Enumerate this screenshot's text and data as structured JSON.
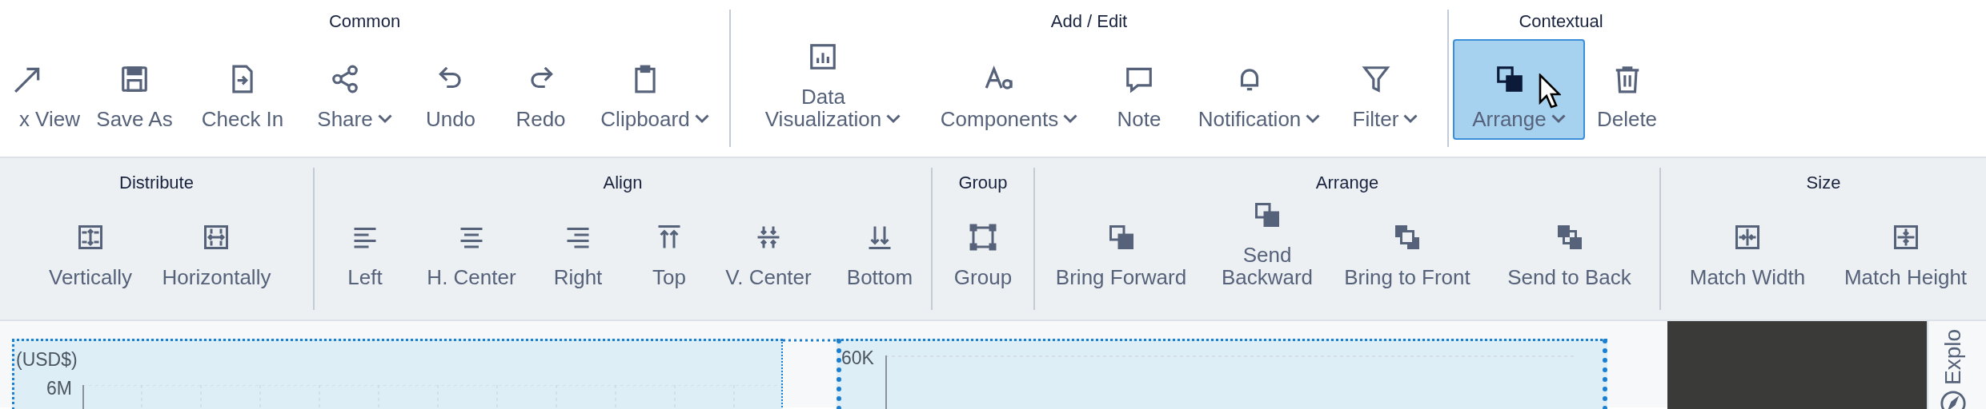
{
  "ribbon": {
    "groups": [
      {
        "label": "Common",
        "items": [
          {
            "label": [
              "x View"
            ],
            "dropdown": false
          },
          {
            "label": [
              "Save As"
            ],
            "dropdown": false
          },
          {
            "label": [
              "Check In"
            ],
            "dropdown": false
          },
          {
            "label": [
              "Share"
            ],
            "dropdown": true
          },
          {
            "label": [
              "Undo"
            ],
            "dropdown": false
          },
          {
            "label": [
              "Redo"
            ],
            "dropdown": false
          },
          {
            "label": [
              "Clipboard"
            ],
            "dropdown": true
          }
        ]
      },
      {
        "label": "Add / Edit",
        "items": [
          {
            "label": [
              "Data",
              "Visualization"
            ],
            "dropdown": true
          },
          {
            "label": [
              "Components"
            ],
            "dropdown": true
          },
          {
            "label": [
              "Note"
            ],
            "dropdown": false
          },
          {
            "label": [
              "Notification"
            ],
            "dropdown": true
          },
          {
            "label": [
              "Filter"
            ],
            "dropdown": true
          }
        ]
      },
      {
        "label": "Contextual",
        "items": [
          {
            "label": [
              "Arrange"
            ],
            "dropdown": true,
            "selected": true
          },
          {
            "label": [
              "Delete"
            ],
            "dropdown": false,
            "selected": false
          }
        ]
      }
    ]
  },
  "subribbon": {
    "groups": [
      {
        "label": "Distribute",
        "items": [
          {
            "label": [
              "Vertically"
            ]
          },
          {
            "label": [
              "Horizontally"
            ]
          }
        ]
      },
      {
        "label": "Align",
        "items": [
          {
            "label": [
              "Left"
            ]
          },
          {
            "label": [
              "H. Center"
            ]
          },
          {
            "label": [
              "Right"
            ]
          },
          {
            "label": [
              "Top"
            ]
          },
          {
            "label": [
              "V. Center"
            ]
          },
          {
            "label": [
              "Bottom"
            ]
          }
        ]
      },
      {
        "label": "Group",
        "items": [
          {
            "label": [
              "Group"
            ]
          }
        ]
      },
      {
        "label": "Arrange",
        "items": [
          {
            "label": [
              "Bring Forward"
            ]
          },
          {
            "label": [
              "Send",
              "Backward"
            ]
          },
          {
            "label": [
              "Bring to Front"
            ]
          },
          {
            "label": [
              "Send to Back"
            ]
          }
        ]
      },
      {
        "label": "Size",
        "items": [
          {
            "label": [
              "Match Width"
            ]
          },
          {
            "label": [
              "Match Height"
            ]
          }
        ]
      }
    ]
  },
  "canvas": {
    "widgets": [
      {
        "kind": "chart",
        "unit_label": "(USD$)",
        "y_tick_label": "6M"
      },
      {
        "kind": "chart",
        "y_tick_label": "60K"
      }
    ]
  },
  "side_panel": {
    "tab_label": "Explo"
  }
}
